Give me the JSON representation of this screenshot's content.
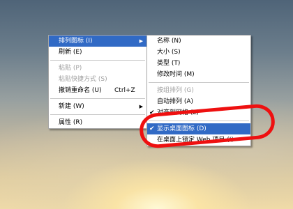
{
  "desktop": {
    "background_colors": [
      "#4f6478",
      "#f0dba8"
    ]
  },
  "context_menu": {
    "items": [
      {
        "label": "排列图标 (I)",
        "submenu_arrow": "▶"
      },
      {
        "label": "刷新 (E)"
      },
      {
        "label": "粘贴 (P)"
      },
      {
        "label": "粘贴快捷方式 (S)"
      },
      {
        "label": "撤销重命名 (U)",
        "shortcut": "Ctrl+Z"
      },
      {
        "label": "新建 (W)",
        "submenu_arrow": "▶"
      },
      {
        "label": "属性 (R)"
      }
    ]
  },
  "arrange_submenu": {
    "items": [
      {
        "label": "名称 (N)"
      },
      {
        "label": "大小 (S)"
      },
      {
        "label": "类型 (T)"
      },
      {
        "label": "修改时间 (M)"
      },
      {
        "label": "按组排列 (G)"
      },
      {
        "label": "自动排列 (A)"
      },
      {
        "label": "对齐到网格 (L)",
        "checkmark": "✔"
      },
      {
        "label": "显示桌面图标 (D)",
        "checkmark": "✔"
      },
      {
        "label": "在桌面上锁定 Web 项目 (I)"
      }
    ]
  },
  "highlight_color": "#316ac5",
  "annotation_color": "#ee1010"
}
